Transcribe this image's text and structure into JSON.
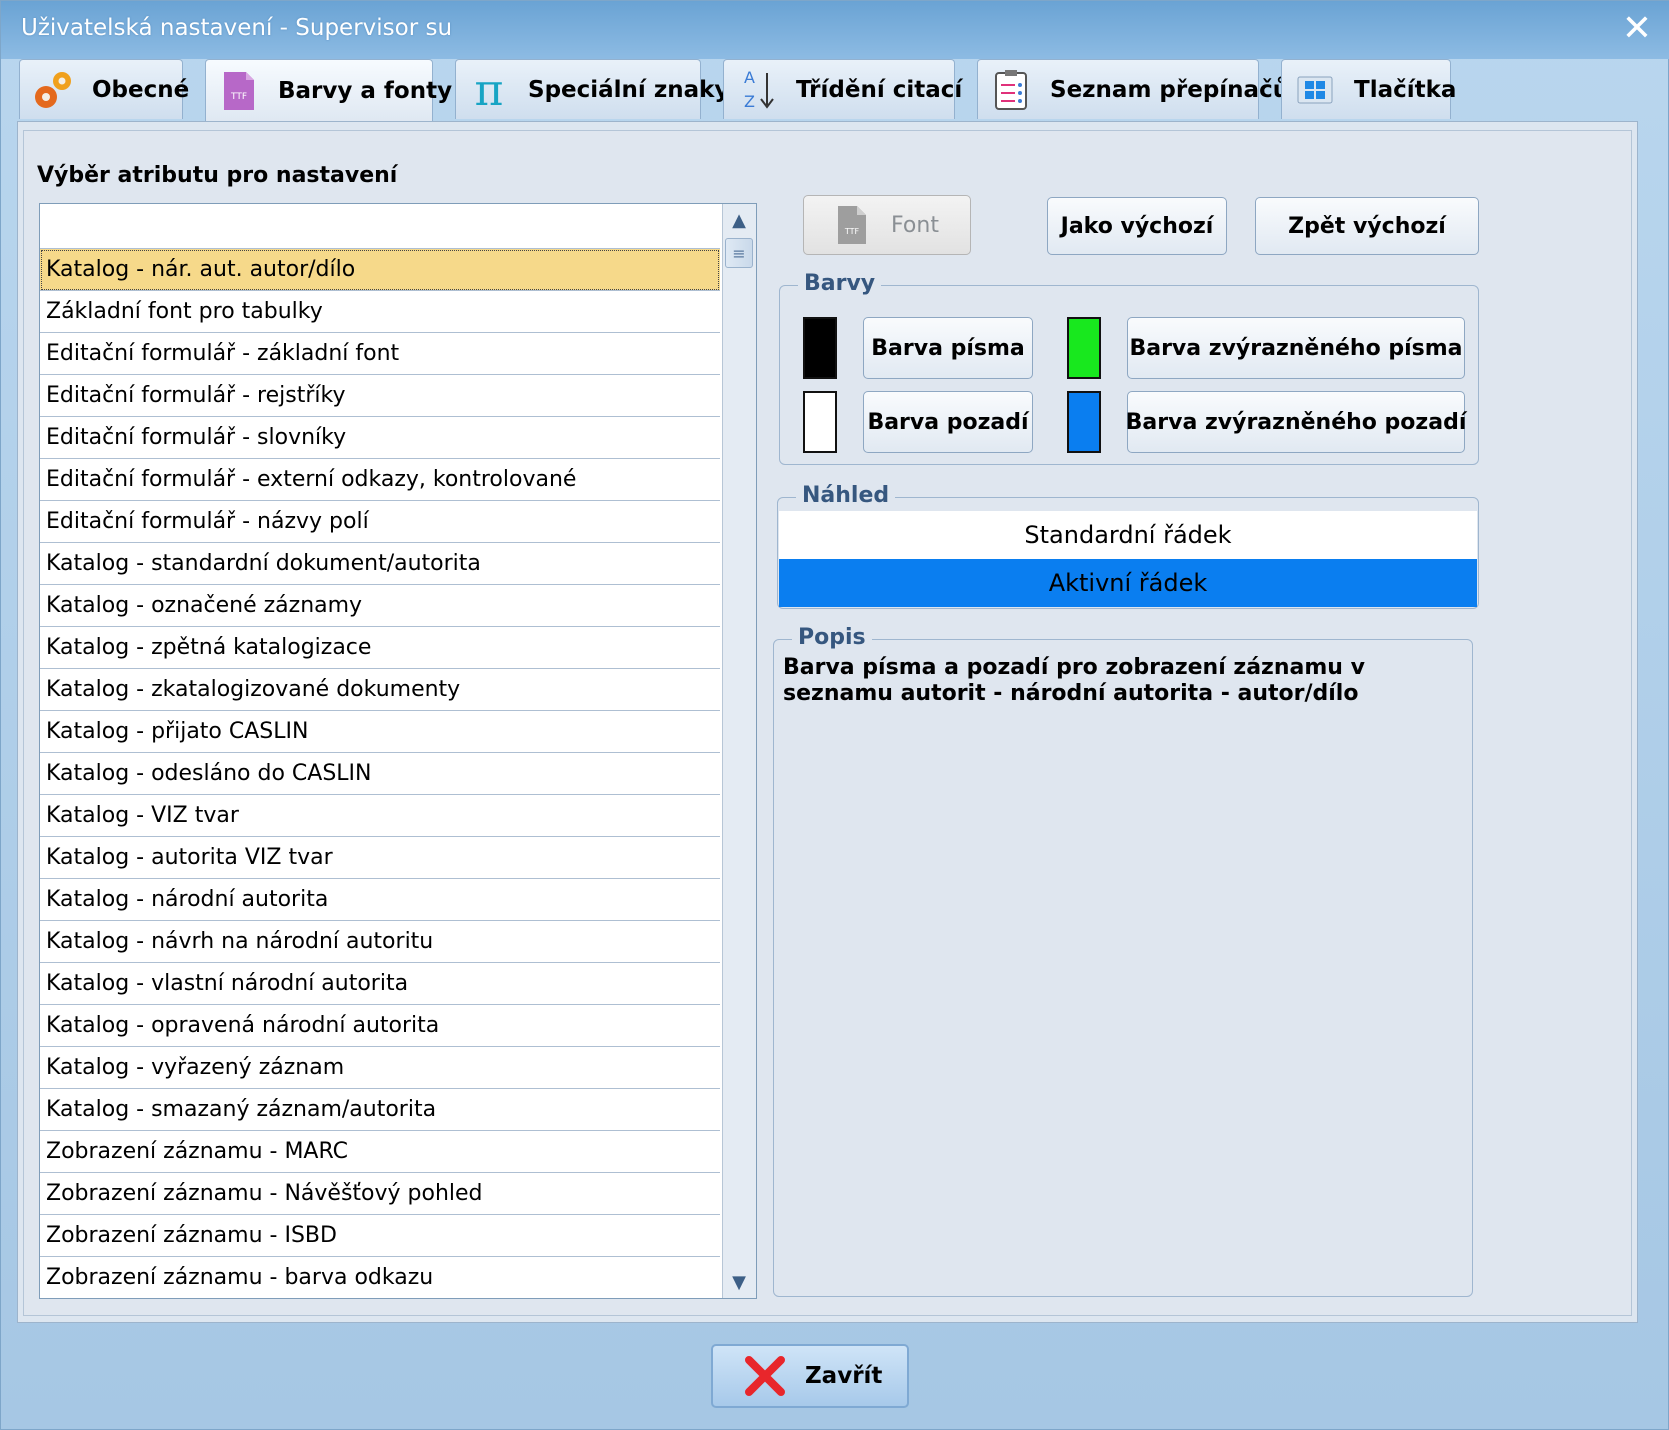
{
  "window": {
    "title": "Uživatelská nastavení - Supervisor su"
  },
  "tabs": [
    {
      "label": "Obecné",
      "icon": "gears-icon"
    },
    {
      "label": "Barvy a fonty",
      "icon": "ttf-file-icon",
      "active": true
    },
    {
      "label": "Speciální znaky",
      "icon": "pi-icon"
    },
    {
      "label": "Třídění citací",
      "icon": "sort-az-icon"
    },
    {
      "label": "Seznam přepínačů",
      "icon": "checklist-icon"
    },
    {
      "label": "Tlačítka",
      "icon": "windows-icon"
    }
  ],
  "attributes": {
    "label": "Výběr atributu pro nastavení",
    "items": [
      "",
      "Katalog - nár. aut. autor/dílo",
      "Základní font pro tabulky",
      "Editační formulář - základní font",
      "Editační formulář - rejstříky",
      "Editační formulář - slovníky",
      "Editační formulář - externí odkazy, kontrolované",
      "Editační formulář - názvy polí",
      "Katalog - standardní dokument/autorita",
      "Katalog - označené záznamy",
      "Katalog - zpětná katalogizace",
      "Katalog - zkatalogizované dokumenty",
      "Katalog - přijato CASLIN",
      "Katalog - odesláno do CASLIN",
      "Katalog - VIZ tvar",
      "Katalog - autorita VIZ tvar",
      "Katalog - národní autorita",
      "Katalog - návrh na národní autoritu",
      "Katalog - vlastní národní autorita",
      "Katalog - opravená národní autorita",
      "Katalog - vyřazený záznam",
      "Katalog - smazaný záznam/autorita",
      "Zobrazení záznamu - MARC",
      "Zobrazení záznamu - Návěšťový pohled",
      "Zobrazení záznamu - ISBD",
      "Zobrazení záznamu - barva odkazu"
    ],
    "selected_index": 1
  },
  "buttons": {
    "font": "Font",
    "as_default": "Jako výchozí",
    "back_default": "Zpět výchozí"
  },
  "colors_group": {
    "title": "Barvy",
    "font_color_label": "Barva písma",
    "font_color": "#000000",
    "highlight_font_label": "Barva zvýrazněného písma",
    "highlight_font_color": "#18e81e",
    "background_label": "Barva pozadí",
    "background_color": "#ffffff",
    "highlight_background_label": "Barva zvýrazněného pozadí",
    "highlight_background_color": "#0a7ef0"
  },
  "preview": {
    "title": "Náhled",
    "standard_row": "Standardní řádek",
    "active_row": "Aktivní řádek"
  },
  "description": {
    "title": "Popis",
    "text": "Barva písma a pozadí pro zobrazení záznamu v seznamu autorit - národní autorita - autor/dílo"
  },
  "footer": {
    "close_label": "Zavřít"
  }
}
